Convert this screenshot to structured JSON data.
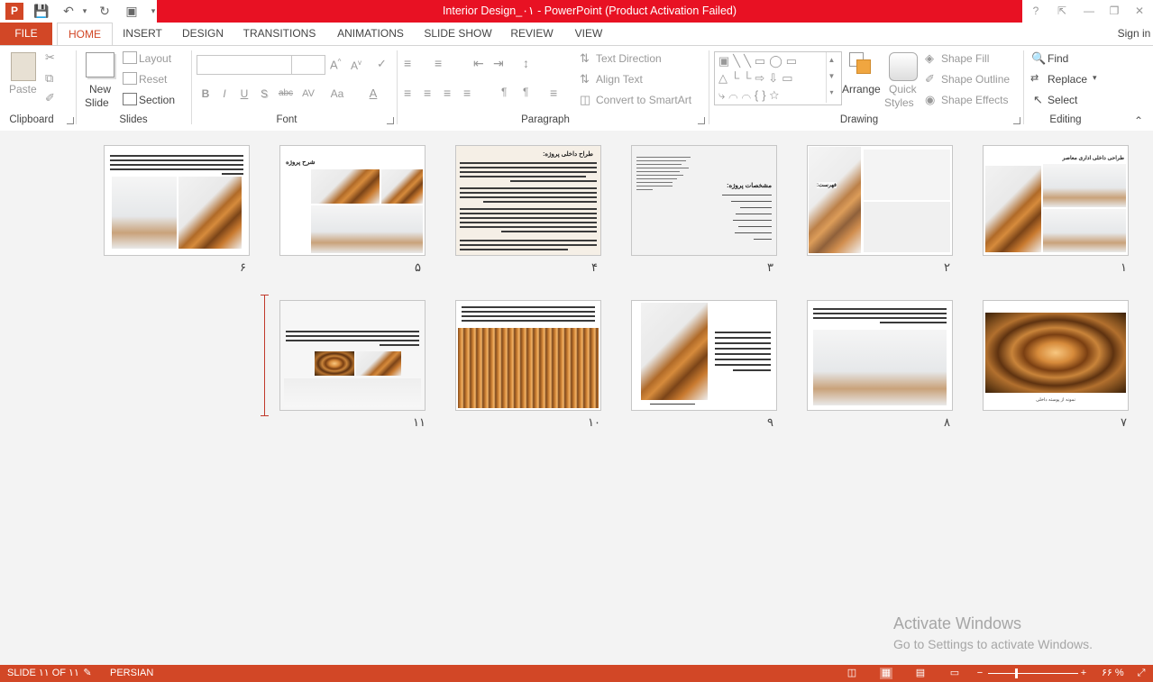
{
  "titlebar": {
    "title": "Interior Design_۰۱ -  PowerPoint (Product Activation Failed)",
    "help": "?",
    "restore_ribbon": "⇱",
    "minimize": "—",
    "maximize": "❐",
    "close": "✕"
  },
  "tabs": {
    "file": "FILE",
    "home": "HOME",
    "insert": "INSERT",
    "design": "DESIGN",
    "transitions": "TRANSITIONS",
    "animations": "ANIMATIONS",
    "slideshow": "SLIDE SHOW",
    "review": "REVIEW",
    "view": "VIEW",
    "signin": "Sign in"
  },
  "ribbon": {
    "clipboard": {
      "label": "Clipboard",
      "paste": "Paste"
    },
    "slides": {
      "label": "Slides",
      "new_slide_1": "New",
      "new_slide_2": "Slide",
      "layout": "Layout",
      "reset": "Reset",
      "section": "Section"
    },
    "font": {
      "label": "Font",
      "bold": "B",
      "italic": "I",
      "underline": "U",
      "shadow": "S",
      "strike": "abc",
      "spacing": "AV",
      "case": "Aa",
      "color": "A"
    },
    "paragraph": {
      "label": "Paragraph",
      "text_direction": "Text Direction",
      "align_text": "Align Text",
      "convert_smartart": "Convert to SmartArt"
    },
    "drawing": {
      "label": "Drawing",
      "arrange": "Arrange",
      "quick_styles_1": "Quick",
      "quick_styles_2": "Styles",
      "shape_fill": "Shape Fill",
      "shape_outline": "Shape Outline",
      "shape_effects": "Shape Effects"
    },
    "editing": {
      "label": "Editing",
      "find": "Find",
      "replace": "Replace",
      "select": "Select"
    }
  },
  "slides": [
    {
      "num": "۱"
    },
    {
      "num": "۲"
    },
    {
      "num": "۳"
    },
    {
      "num": "۴"
    },
    {
      "num": "۵"
    },
    {
      "num": "۶"
    },
    {
      "num": "۷"
    },
    {
      "num": "۸"
    },
    {
      "num": "۹"
    },
    {
      "num": "۱۰"
    },
    {
      "num": "۱۱"
    }
  ],
  "slide_text": {
    "s1_title": "طراحی داخلی اداری معاصر",
    "s3_title": "مشخصات پروژه:",
    "s4_title": "طراح داخلی پروژه:",
    "s5_title": "شرح پروژه",
    "s2_title": "فهرست:",
    "s7_caption": "نمونه از پوسته داخلی"
  },
  "watermark": {
    "line1": "Activate Windows",
    "line2": "Go to Settings to activate Windows."
  },
  "status": {
    "slide_info": "SLIDE ۱۱ OF ۱۱",
    "language": "PERSIAN",
    "zoom": "۶۶ %",
    "zoom_level": 0.66
  },
  "colors": {
    "accent": "#d24726",
    "title_red": "#e81123"
  }
}
